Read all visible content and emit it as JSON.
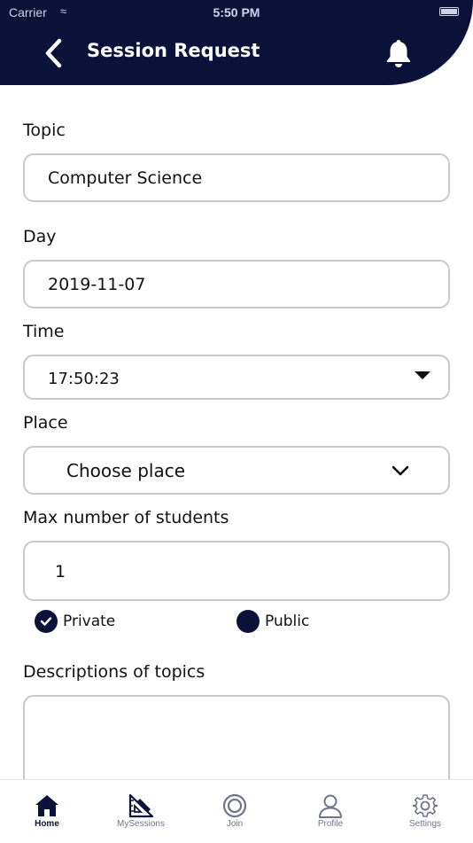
{
  "status_bar": {
    "carrier": "Carrier",
    "time": "5:50 PM"
  },
  "header": {
    "title": "Session Request"
  },
  "form": {
    "topic_label": "Topic",
    "topic_value": "Computer Science",
    "day_label": "Day",
    "day_value": "2019-11-07",
    "time_label": "Time",
    "time_value": "17:50:23",
    "place_label": "Place",
    "place_value": "Choose place",
    "max_students_label": "Max number of students",
    "max_students_value": "1",
    "visibility_options": [
      {
        "label": "Private",
        "selected": true
      },
      {
        "label": "Public",
        "selected": false
      }
    ],
    "descriptions_label": "Descriptions of topics",
    "descriptions_value": ""
  },
  "tabbar": {
    "tabs": [
      {
        "label": "Home",
        "icon": "home-icon",
        "active": true
      },
      {
        "label": "MySessions",
        "icon": "set-square-icon",
        "active": false
      },
      {
        "label": "Join",
        "icon": "target-icon",
        "active": false
      },
      {
        "label": "Profile",
        "icon": "person-icon",
        "active": false
      },
      {
        "label": "Settings",
        "icon": "gear-icon",
        "active": false
      }
    ]
  },
  "colors": {
    "brand_navy": "#0b1239",
    "field_border": "#c9c9c9",
    "tab_inactive": "#6f7489"
  }
}
